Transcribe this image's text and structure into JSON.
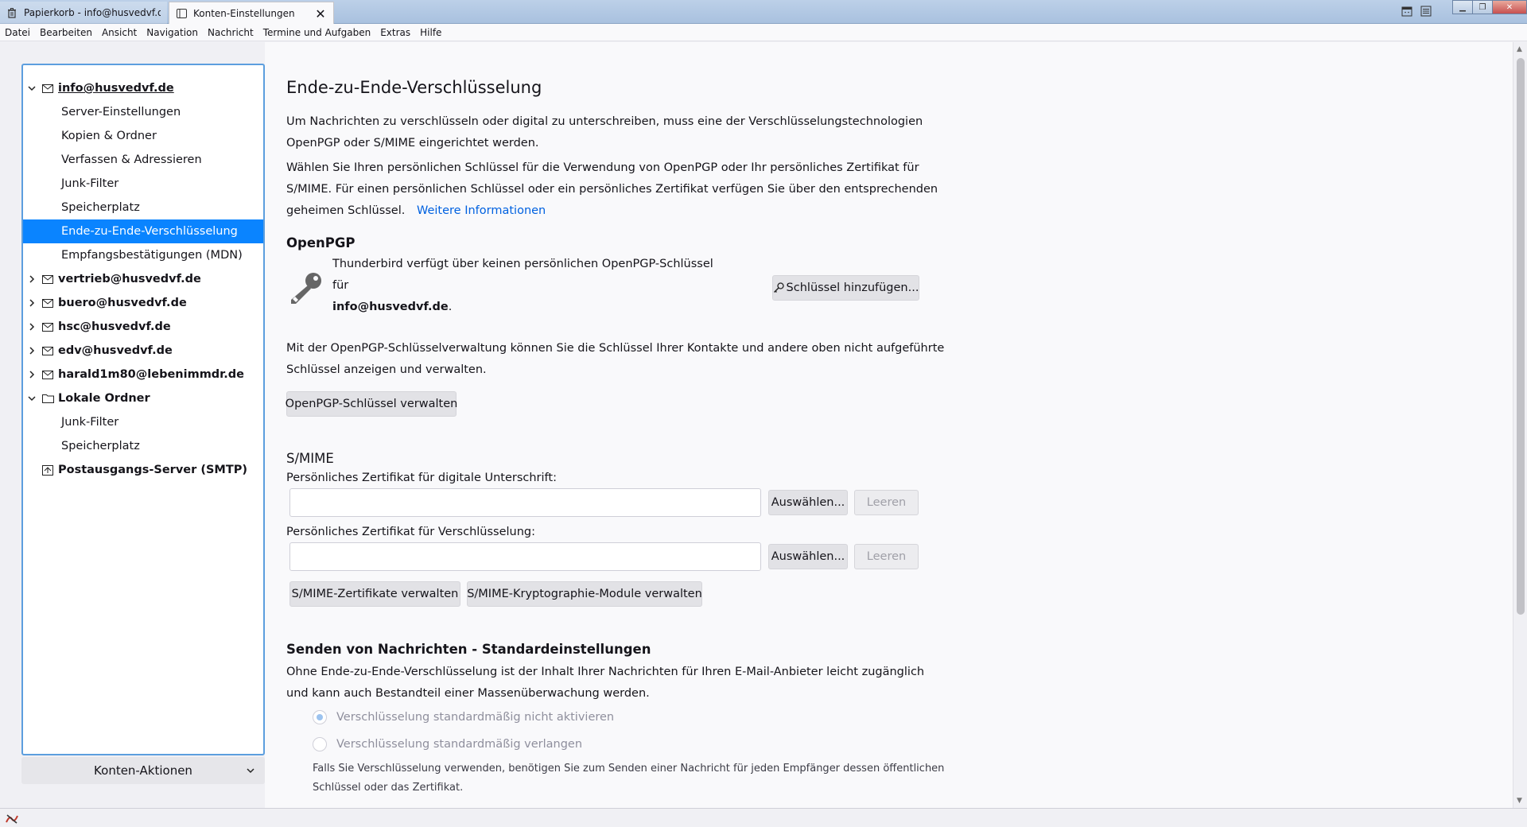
{
  "tabs": [
    {
      "label": "Papierkorb - info@husvedvf.de",
      "icon": "trash-icon"
    },
    {
      "label": "Konten-Einstellungen",
      "icon": "settings-tab-icon",
      "close": "✕"
    }
  ],
  "menubar": [
    "Datei",
    "Bearbeiten",
    "Ansicht",
    "Navigation",
    "Nachricht",
    "Termine und Aufgaben",
    "Extras",
    "Hilfe"
  ],
  "sidebar": {
    "accounts": [
      {
        "label": "info@husvedvf.de",
        "expanded": true,
        "icon": "mail-icon"
      },
      {
        "label": "vertrieb@husvedvf.de",
        "expanded": false,
        "icon": "mail-icon"
      },
      {
        "label": "buero@husvedvf.de",
        "expanded": false,
        "icon": "mail-icon"
      },
      {
        "label": "hsc@husvedvf.de",
        "expanded": false,
        "icon": "mail-icon"
      },
      {
        "label": "edv@husvedvf.de",
        "expanded": false,
        "icon": "mail-icon"
      },
      {
        "label": "harald1m80@lebenimmdr.de",
        "expanded": false,
        "icon": "mail-icon"
      },
      {
        "label": "Lokale Ordner",
        "expanded": true,
        "icon": "folder-icon"
      },
      {
        "label": "Postausgangs-Server (SMTP)",
        "icon": "outbox-server-icon"
      }
    ],
    "info_children": [
      "Server-Einstellungen",
      "Kopien & Ordner",
      "Verfassen & Adressieren",
      "Junk-Filter",
      "Speicherplatz",
      "Ende-zu-Ende-Verschlüsselung",
      "Empfangsbestätigungen (MDN)"
    ],
    "local_children": [
      "Junk-Filter",
      "Speicherplatz"
    ],
    "selected": "Ende-zu-Ende-Verschlüsselung",
    "account_actions": "Konten-Aktionen"
  },
  "main": {
    "title": "Ende-zu-Ende-Verschlüsselung",
    "intro1": "Um Nachrichten zu verschlüsseln oder digital zu unterschreiben, muss eine der Verschlüsselungstechnologien OpenPGP oder S/MIME eingerichtet werden.",
    "intro2": "Wählen Sie Ihren persönlichen Schlüssel für die Verwendung von OpenPGP oder Ihr persönliches Zertifikat für S/MIME. Für einen persönlichen Schlüssel oder ein persönliches Zertifikat verfügen Sie über den entsprechenden geheimen Schlüssel.",
    "more_info": "Weitere Informationen",
    "openpgp": {
      "heading": "OpenPGP",
      "no_key_text": "Thunderbird verfügt über keinen persönlichen OpenPGP-Schlüssel für",
      "account": "info@husvedvf.de",
      "add_key": "Schlüssel hinzufügen...",
      "manager_text": "Mit der OpenPGP-Schlüsselverwaltung können Sie die Schlüssel Ihrer Kontakte und andere oben nicht aufgeführte Schlüssel anzeigen und verwalten.",
      "manage_button": "OpenPGP-Schlüssel verwalten"
    },
    "smime": {
      "heading": "S/MIME",
      "signing_label": "Persönliches Zertifikat für digitale Unterschrift:",
      "signing_value": "",
      "encryption_label": "Persönliches Zertifikat für Verschlüsselung:",
      "encryption_value": "",
      "select": "Auswählen...",
      "clear": "Leeren",
      "manage_certs": "S/MIME-Zertifikate verwalten",
      "manage_modules": "S/MIME-Kryptographie-Module verwalten"
    },
    "sending": {
      "heading": "Senden von Nachrichten - Standardeinstellungen",
      "text": "Ohne Ende-zu-Ende-Verschlüsselung ist der Inhalt Ihrer Nachrichten für Ihren E-Mail-Anbieter leicht zugänglich und kann auch Bestandteil einer Massenüberwachung werden.",
      "option1": "Verschlüsselung standardmäßig nicht aktivieren",
      "option1_checked": true,
      "option2": "Verschlüsselung standardmäßig verlangen",
      "option2_checked": false,
      "note": "Falls Sie Verschlüsselung verwenden, benötigen Sie zum Senden einer Nachricht für jeden Empfänger dessen öffentlichen Schlüssel oder das Zertifikat."
    }
  },
  "colors": {
    "accent": "#0a84ff",
    "link": "#0061e0",
    "tree_border": "#5c9ede"
  }
}
